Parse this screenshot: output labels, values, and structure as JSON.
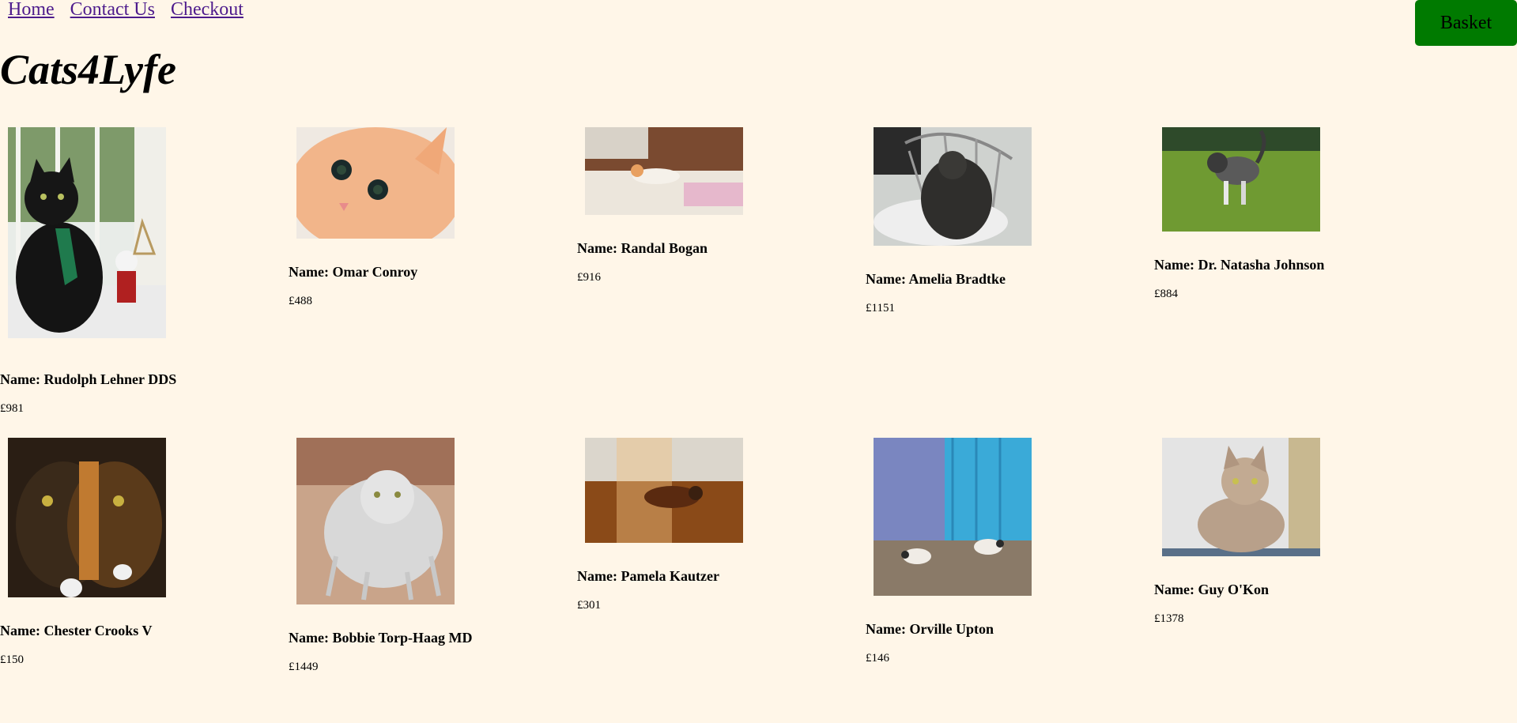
{
  "nav": {
    "home": "Home",
    "contact": "Contact Us",
    "checkout": "Checkout"
  },
  "basket_label": "Basket",
  "site_title": "Cats4Lyfe",
  "cats": [
    {
      "name": "Name: Rudolph Lehner DDS",
      "price": "£981"
    },
    {
      "name": "Name: Omar Conroy",
      "price": "£488"
    },
    {
      "name": "Name: Randal Bogan",
      "price": "£916"
    },
    {
      "name": "Name: Amelia Bradtke",
      "price": "£1151"
    },
    {
      "name": "Name: Dr. Natasha Johnson",
      "price": "£884"
    },
    {
      "name": "Name: Chester Crooks V",
      "price": "£150"
    },
    {
      "name": "Name: Bobbie Torp-Haag MD",
      "price": "£1449"
    },
    {
      "name": "Name: Pamela Kautzer",
      "price": "£301"
    },
    {
      "name": "Name: Orville Upton",
      "price": "£146"
    },
    {
      "name": "Name: Guy O'Kon",
      "price": "£1378"
    }
  ],
  "colors": {
    "background": "#fff6e8",
    "link": "#4d1b8c",
    "basket": "#007a00"
  }
}
